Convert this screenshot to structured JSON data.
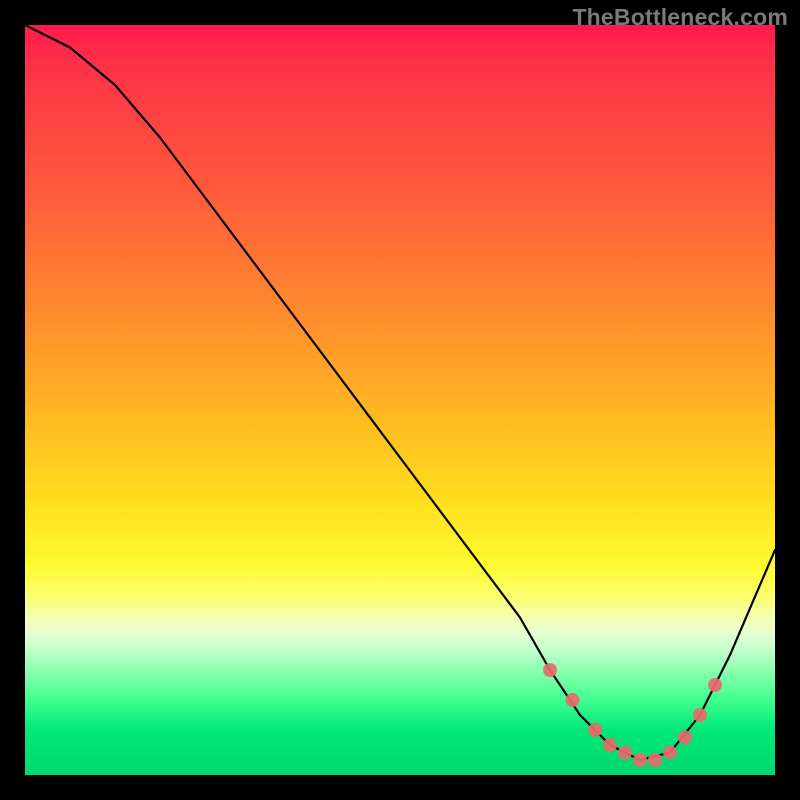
{
  "watermark": "TheBottleneck.com",
  "chart_data": {
    "type": "line",
    "title": "",
    "xlabel": "",
    "ylabel": "",
    "xlim": [
      0,
      100
    ],
    "ylim": [
      0,
      100
    ],
    "series": [
      {
        "name": "bottleneck-curve",
        "x": [
          0,
          6,
          12,
          18,
          24,
          30,
          36,
          42,
          48,
          54,
          60,
          66,
          70,
          74,
          78,
          82,
          86,
          90,
          94,
          100
        ],
        "values": [
          100,
          97,
          92,
          85,
          77,
          69,
          61,
          53,
          45,
          37,
          29,
          21,
          14,
          8,
          4,
          2,
          3,
          8,
          16,
          30
        ]
      }
    ],
    "markers": {
      "name": "highlight-dots",
      "x": [
        70,
        73,
        76,
        78,
        80,
        82,
        84,
        86,
        88,
        90,
        92
      ],
      "values": [
        14,
        10,
        6,
        4,
        3,
        2,
        2,
        3,
        5,
        8,
        12
      ]
    },
    "gradient_stops": [
      {
        "pos": 0,
        "color": "#ff1a4d"
      },
      {
        "pos": 50,
        "color": "#ffb020"
      },
      {
        "pos": 75,
        "color": "#fffa30"
      },
      {
        "pos": 100,
        "color": "#00d86e"
      }
    ]
  }
}
